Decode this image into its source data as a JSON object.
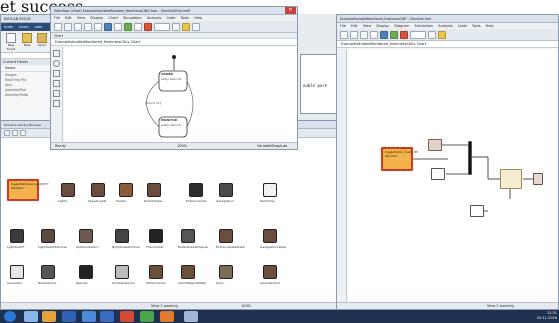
{
  "top_text": "et success.",
  "left_app": {
    "title": "MATLAB R2016",
    "tabs": [
      "HOME",
      "PLOTS",
      "APPS"
    ],
    "toolbar_labels": [
      "New Script",
      "New",
      "Open"
    ],
    "current_folder_label": "Current Folder",
    "folder_header": "Name",
    "files": [
      "images",
      "RealTime_Pac",
      "slprj",
      "AlarmKeyPad",
      "AlarmKeyPadA"
    ],
    "ws_title": "Command Window"
  },
  "stateflow": {
    "title": "Stateflow (chart) ExampleVariableRandom_freshnessCIN/Chart - SimulinkTrial.mdl*",
    "menu": [
      "File",
      "Edit",
      "View",
      "Display",
      "Chart",
      "Simulation",
      "Analysis",
      "Code",
      "Tools",
      "Help"
    ],
    "breadcrumb_tab": "Chart",
    "breadcrumb": "ExampleVariableMonitored_freshnessCIN",
    "breadcrumb_leaf": "Chart",
    "state1_name": "ARMED",
    "state1_entry": "entry:mon=0;",
    "state2_name": "MONITOR",
    "state2_entry": "entry:mon=1;",
    "transition": "[mon==1]",
    "status_left": "Ready",
    "status_mid": "100%",
    "status_right": "VariableStepAuto"
  },
  "side_code": {
    "line1": "ouble pure"
  },
  "library": {
    "title": "Simulink Library Browser",
    "highlight_block_label": "toggleButtonGroup_DUSTY labelText",
    "status_mid": "View 1 warning",
    "status_right": "100%",
    "blocks": [
      {
        "label": "Lights"
      },
      {
        "label": "SpeedLights"
      },
      {
        "label": "Heater"
      },
      {
        "label": "RadioHeater"
      },
      {
        "label": "EntranceGate"
      },
      {
        "label": "GarageDoor"
      },
      {
        "label": "DateTime"
      },
      {
        "label": "LightSwitch"
      },
      {
        "label": "LightSwitchDimmer"
      },
      {
        "label": "UpDownSwitch"
      },
      {
        "label": "BrightnessDimmer"
      },
      {
        "label": "Thermostat"
      },
      {
        "label": "RollerShadesOpener"
      },
      {
        "label": "EntranceGateState"
      },
      {
        "label": "GarageDoorState"
      },
      {
        "label": "Generator"
      },
      {
        "label": "BoxDetector"
      },
      {
        "label": "Remote"
      },
      {
        "label": "SmokeDetector"
      },
      {
        "label": "MotionSensor"
      },
      {
        "label": "AlarmMagnetState"
      },
      {
        "label": "Siren"
      },
      {
        "label": "AlarmKeyPad"
      },
      {
        "label": "Weather"
      }
    ]
  },
  "simulink": {
    "title": "ExampleVariableMonitored_freshnessCIN* - Simulink trial",
    "menu": [
      "File",
      "Edit",
      "View",
      "Display",
      "Diagram",
      "Simulation",
      "Analysis",
      "Code",
      "Tools",
      "Help"
    ],
    "breadcrumb": "ExampleVariableMonitored_freshnessCIN",
    "breadcrumb_leaf": "Chart",
    "highlight_label": "toggleButton_Dusty_BP labelText",
    "status_right": "View 1 warning"
  },
  "taskbar": {
    "tray_clock": "12:31",
    "tray_date": "20-11-2016"
  }
}
